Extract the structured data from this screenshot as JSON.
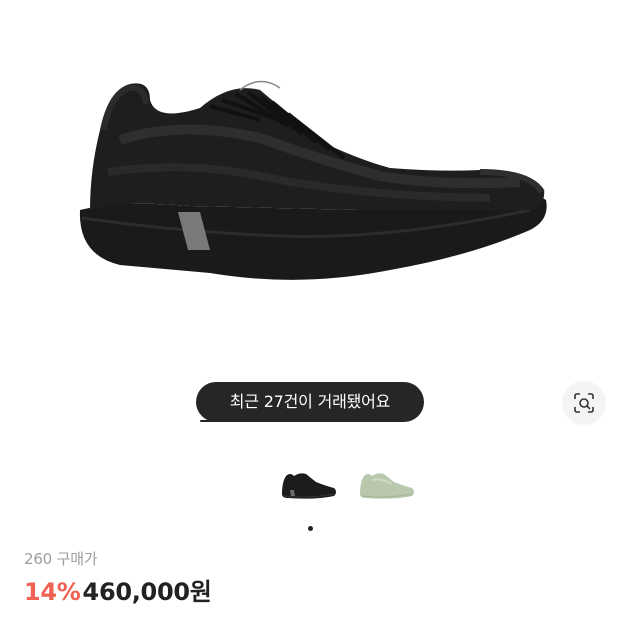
{
  "toast": {
    "text": "최근 27건이 거래됐어요"
  },
  "product": {
    "size_label": "260 구매가",
    "discount": "14%",
    "price": "460,000원"
  },
  "gallery": {
    "thumbnails": [
      {
        "color": "#1c1c1c",
        "icon": "black-shoe-thumbnail"
      },
      {
        "color": "#b9c8ad",
        "icon": "mint-shoe-thumbnail"
      }
    ],
    "pager_count": 1
  },
  "icons": {
    "lens": "lens-search-icon"
  },
  "colors": {
    "discount": "#ef6253",
    "toast_bg": "#262626"
  }
}
